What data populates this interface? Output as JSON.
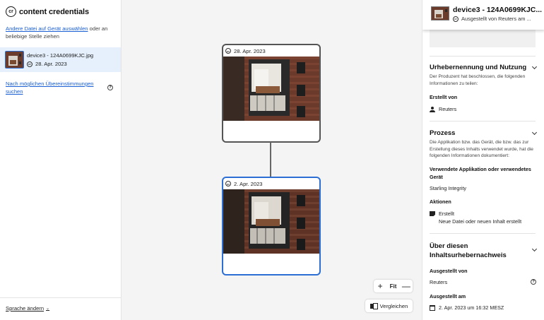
{
  "app": {
    "brand": "content credentials",
    "logo_text": "cr"
  },
  "left": {
    "choose_link": "Andere Datei auf Gerät auswählen",
    "choose_rest": " oder an beliebige Stelle ziehen",
    "file": {
      "name": "device3 - 124A0699KJC.jpg",
      "date": "28. Apr. 2023"
    },
    "matches_link": "Nach möglichen Übereinstimmungen suchen",
    "help_glyph": "?",
    "language": "Sprache ändern",
    "language_chevron": "⌄"
  },
  "canvas": {
    "nodes": [
      {
        "date": "28. Apr. 2023"
      },
      {
        "date": "2. Apr. 2023"
      }
    ],
    "zoom": {
      "plus": "+",
      "fit": "Fit",
      "minus": "—"
    },
    "compare": "Vergleichen"
  },
  "right": {
    "title": "device3 - 124A0699KJC...",
    "issuer": "Ausgestellt von Reuters am ...",
    "sections": {
      "attribution": {
        "title": "Urhebernennung und Nutzung",
        "desc": "Der Produzent hat beschlossen, die folgenden Informationen zu teilen:",
        "created_by_label": "Erstellt von",
        "created_by_value": "Reuters"
      },
      "process": {
        "title": "Prozess",
        "desc": "Die Applikation bzw. das Gerät, die bzw. das zur Erstellung dieses Inhalts verwendet wurde, hat die folgenden Informationen dokumentiert:",
        "app_label": "Verwendete Applikation oder verwendetes Gerät",
        "app_value": "Starling Integrity",
        "actions_label": "Aktionen",
        "action_title": "Erstellt",
        "action_desc": "Neue Datei oder neuen Inhalt erstellt"
      },
      "about": {
        "title": "Über diesen Inhaltsurhebernachweis",
        "issued_by_label": "Ausgestellt von",
        "issued_by_value": "Reuters",
        "issued_on_label": "Ausgestellt am",
        "issued_on_value": "2. Apr. 2023 um 16:32 MESZ"
      }
    }
  },
  "colors": {
    "accent": "#2c6fd4",
    "link": "#1a5fd4",
    "canvas_bg": "#f4f4f4",
    "selected_bg": "#e5f0fc"
  }
}
